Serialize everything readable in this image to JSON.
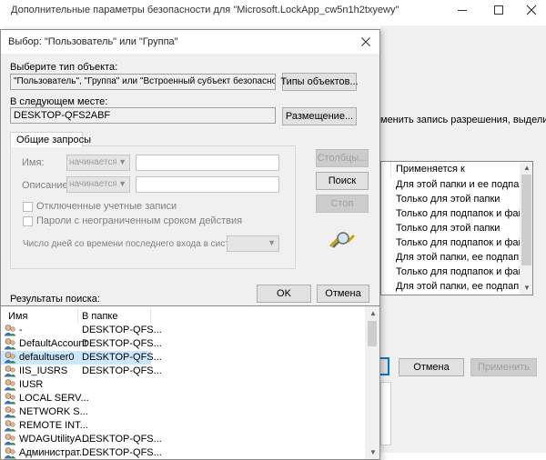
{
  "bg_window": {
    "title": "Дополнительные параметры безопасности  для \"Microsoft.LockApp_cw5n1h2txyewy\"",
    "hint": "менить запись разрешения, выделите",
    "applies_header": "Применяется к",
    "applies_rows": [
      "Для этой папки и ее подпап",
      "Только для этой папки",
      "Только для подпапок и фай...",
      "Только для этой папки",
      "Только для подпапок и фай...",
      "Для этой папки, ее подпап...",
      "Только для подпапок и фай...",
      "Для этой папки, ее подпап..."
    ],
    "cancel_label": "Отмена",
    "apply_label": "Применить"
  },
  "dialog": {
    "title": "Выбор: \"Пользователь\" или \"Группа\"",
    "object_type_label": "Выберите тип объекта:",
    "object_type_value": "\"Пользователь\", \"Группа\" или \"Встроенный субъект безопасности\"",
    "object_types_button": "Типы объектов...",
    "location_label": "В следующем месте:",
    "location_value": "DESKTOP-QFS2ABF",
    "location_button": "Размещение...",
    "tab_label": "Общие запросы",
    "name_label": "Имя:",
    "description_label": "Описание:",
    "starts_with": "начинается с",
    "disabled_accounts_label": "Отключенные учетные записи",
    "no_expire_label": "Пароли с неограниченным сроком действия",
    "days_label": "Число дней со времени последнего входа в систему:",
    "columns_button": "Столбцы...",
    "search_button": "Поиск",
    "stop_button": "Стоп",
    "ok_button": "OK",
    "cancel_button": "Отмена",
    "results_label": "Результаты поиска:",
    "col_name": "Имя",
    "col_folder": "В папке",
    "results": [
      {
        "name": "-",
        "folder": "DESKTOP-QFS..."
      },
      {
        "name": "DefaultAccount",
        "folder": "DESKTOP-QFS..."
      },
      {
        "name": "defaultuser0",
        "folder": "DESKTOP-QFS..."
      },
      {
        "name": "IIS_IUSRS",
        "folder": "DESKTOP-QFS..."
      },
      {
        "name": "IUSR",
        "folder": ""
      },
      {
        "name": "LOCAL SERV...",
        "folder": ""
      },
      {
        "name": "NETWORK S...",
        "folder": ""
      },
      {
        "name": "REMOTE INT...",
        "folder": ""
      },
      {
        "name": "WDAGUtilityA...",
        "folder": "DESKTOP-QFS..."
      },
      {
        "name": "Администрат...",
        "folder": "DESKTOP-QFS..."
      }
    ]
  },
  "icons": {
    "close": "close-icon",
    "minimize": "minimize-icon",
    "maximize": "maximize-icon",
    "search": "search-magnifier-icon",
    "user": "user-icon"
  },
  "colors": {
    "selected_row": "#cce8ff",
    "accent": "#0078d7",
    "dialog_bg": "#f0f0f0"
  }
}
